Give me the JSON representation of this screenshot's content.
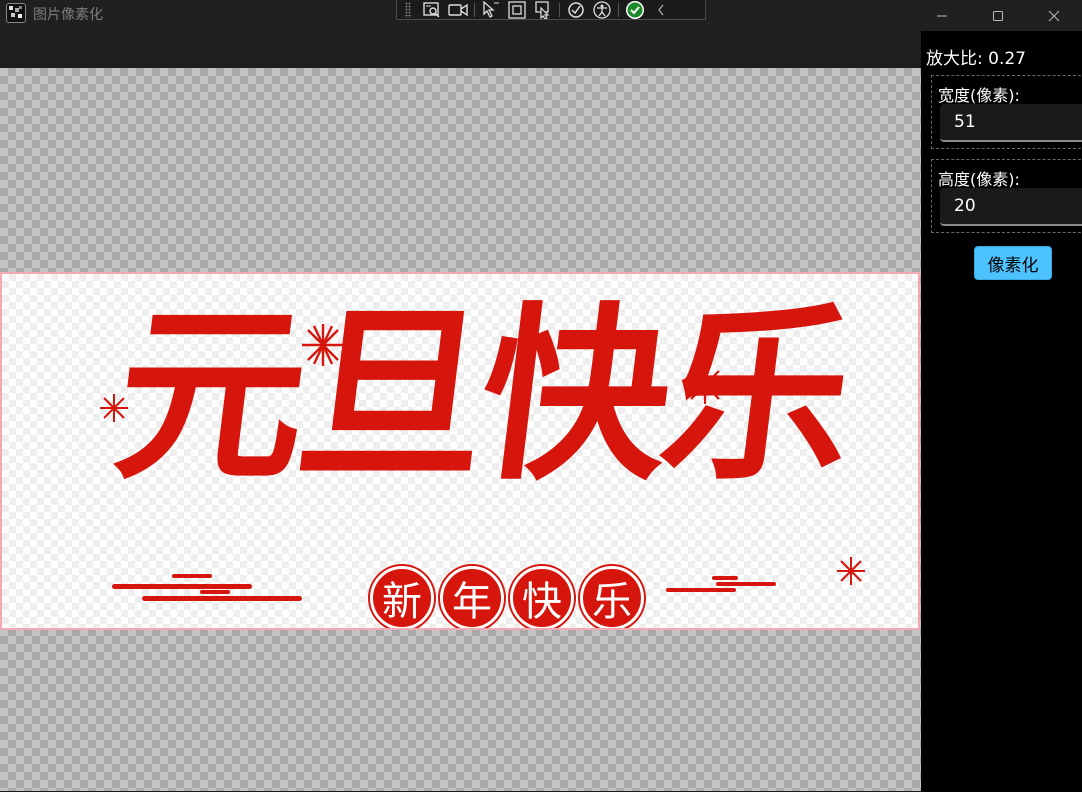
{
  "window": {
    "title": "图片像素化",
    "controls": [
      "minimize",
      "maximize",
      "close"
    ]
  },
  "debug_toolbar": {
    "icons": [
      "live-visual-tree-icon",
      "record-icon",
      "select-element-icon",
      "display-layout-adorners-icon",
      "track-focus-icon",
      "hot-reload-icon",
      "accessibility-checker-icon",
      "binding-failures-check-icon",
      "collapse-chevron-icon"
    ]
  },
  "image": {
    "title": "元旦快乐",
    "subtitle_chars": [
      "新",
      "年",
      "快",
      "乐"
    ],
    "colors": {
      "red": "#d6150c",
      "frame_border": "#f2a9b3"
    }
  },
  "sidebar": {
    "zoom_label": "放大比: 0.27",
    "width_label": "宽度(像素):",
    "width_value": "51",
    "height_label": "高度(像素):",
    "height_value": "20",
    "pixelate_button": "像素化",
    "accent_color": "#4cc2ff"
  }
}
